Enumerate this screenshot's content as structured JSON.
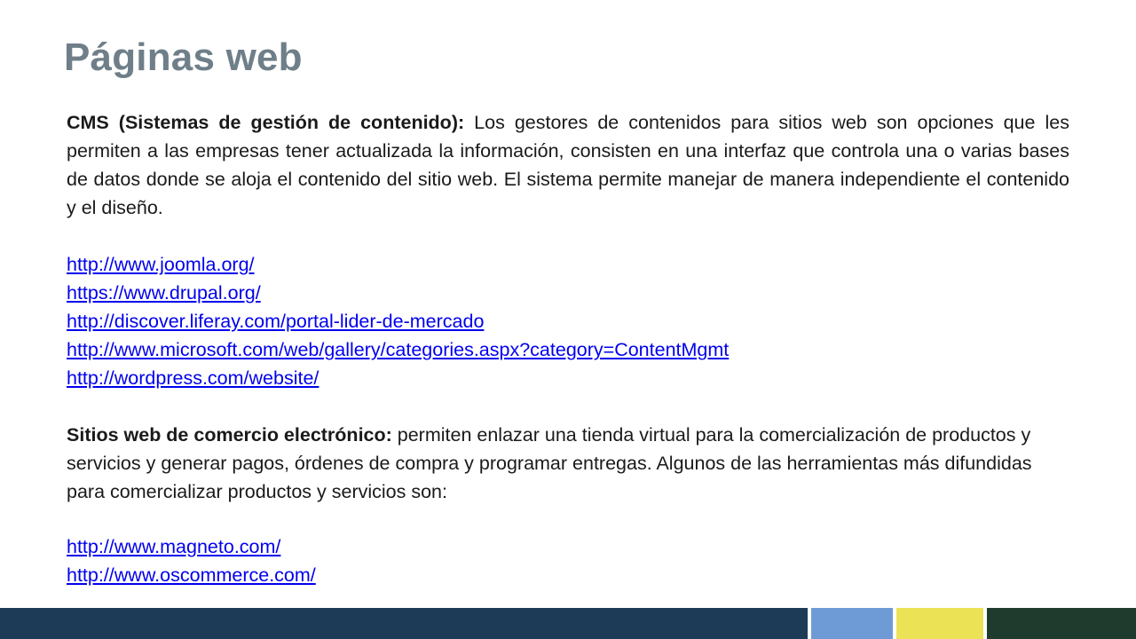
{
  "slide": {
    "title": "Páginas web",
    "cms": {
      "label": "CMS (Sistemas de gestión de contenido):",
      "text": " Los gestores de contenidos para sitios web son opciones que les permiten a las empresas tener actualizada la información, consisten en una interfaz que controla una o varias bases de datos donde se aloja el contenido del sitio web. El sistema permite manejar de manera independiente el contenido y el diseño.",
      "links": [
        "http://www.joomla.org/",
        "https://www.drupal.org/",
        "http://discover.liferay.com/portal-lider-de-mercado",
        "http://www.microsoft.com/web/gallery/categories.aspx?category=ContentMgmt",
        "http://wordpress.com/website/"
      ]
    },
    "ecommerce": {
      "label": "Sitios web de comercio electrónico:",
      "text": " permiten enlazar una tienda virtual para la comercialización de productos y servicios y generar pagos, órdenes de compra y programar entregas. Algunos de las herramientas más difundidas para comercializar productos y servicios son:",
      "links": [
        "http://www.magneto.com/",
        "http://www.oscommerce.com/"
      ]
    }
  },
  "colors": {
    "title": "#6f7f89",
    "link": "#0000ee",
    "footer_navy": "#1d3a56",
    "footer_blue": "#6e9bd6",
    "footer_yellow": "#ece256",
    "footer_green": "#1f3b2d"
  }
}
